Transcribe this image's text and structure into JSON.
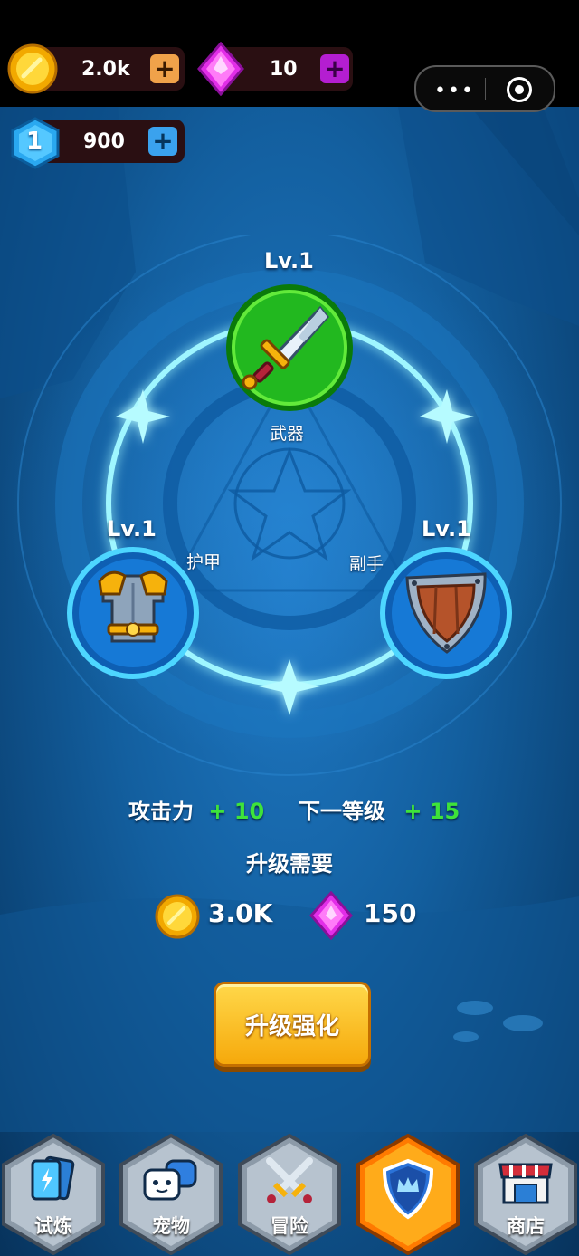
{
  "hud": {
    "gold": "2.0k",
    "gems": "10",
    "level_badge": "1",
    "trophies": "900"
  },
  "equipment": {
    "weapon": {
      "level": "Lv.1",
      "name": "武器"
    },
    "armor": {
      "level": "Lv.1",
      "name": "护甲"
    },
    "offhand": {
      "level": "Lv.1",
      "name": "副手"
    }
  },
  "stats": {
    "attack_label": "攻击力",
    "attack_bonus": "+ 10",
    "next_label": "下一等级",
    "next_bonus": "+ 15"
  },
  "upgrade": {
    "requirement_label": "升级需要",
    "gold_cost": "3.0K",
    "gem_cost": "150",
    "button_label": "升级强化"
  },
  "nav": {
    "items": [
      {
        "label": "试炼",
        "icon": "cards-icon"
      },
      {
        "label": "宠物",
        "icon": "pet-icon"
      },
      {
        "label": "冒险",
        "icon": "crossed-swords-icon"
      },
      {
        "label": "",
        "icon": "shield-crown-icon",
        "active": true
      },
      {
        "label": "商店",
        "icon": "shop-icon"
      }
    ]
  },
  "colors": {
    "accent_gold": "#f6a90b",
    "active_tab": "#ff9a00",
    "green_bonus": "#3ee33a",
    "ring_glow": "#7ff3ff"
  }
}
